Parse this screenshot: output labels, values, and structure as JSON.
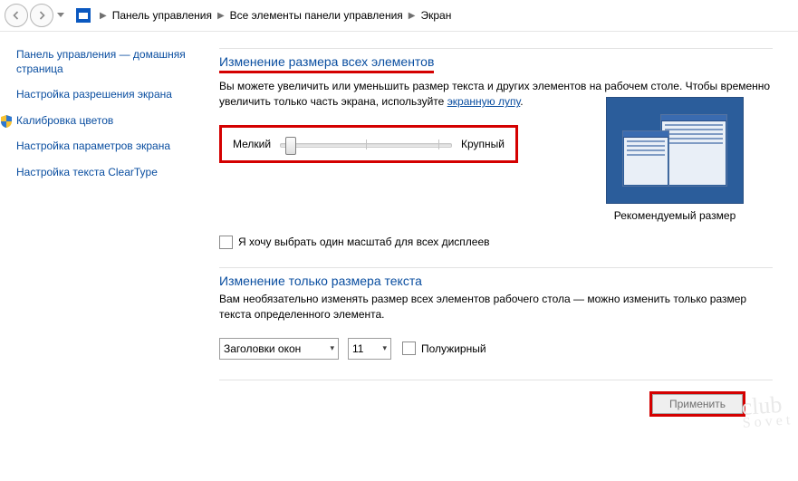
{
  "breadcrumb": {
    "items": [
      "Панель управления",
      "Все элементы панели управления",
      "Экран"
    ]
  },
  "sidebar": {
    "home": "Панель управления — домашняя страница",
    "links": [
      "Настройка разрешения экрана",
      "Калибровка цветов",
      "Настройка параметров экрана",
      "Настройка текста ClearType"
    ]
  },
  "main": {
    "title": "Изменение размера всех элементов",
    "desc_prefix": "Вы можете увеличить или уменьшить размер текста и других элементов на рабочем столе. Чтобы временно увеличить только часть экрана, используйте ",
    "desc_link": "экранную лупу",
    "desc_suffix": ".",
    "slider": {
      "min_label": "Мелкий",
      "max_label": "Крупный"
    },
    "preview_label": "Рекомендуемый размер",
    "same_scale_label": "Я хочу выбрать один масштаб для всех дисплеев",
    "section2_title": "Изменение только размера текста",
    "section2_desc": "Вам необязательно изменять размер всех элементов рабочего стола — можно изменить только размер текста определенного элемента.",
    "element_select": "Заголовки окон",
    "size_select": "11",
    "bold_label": "Полужирный",
    "apply_label": "Применить"
  },
  "watermark": {
    "line1": "club",
    "line2": "Sovet"
  }
}
